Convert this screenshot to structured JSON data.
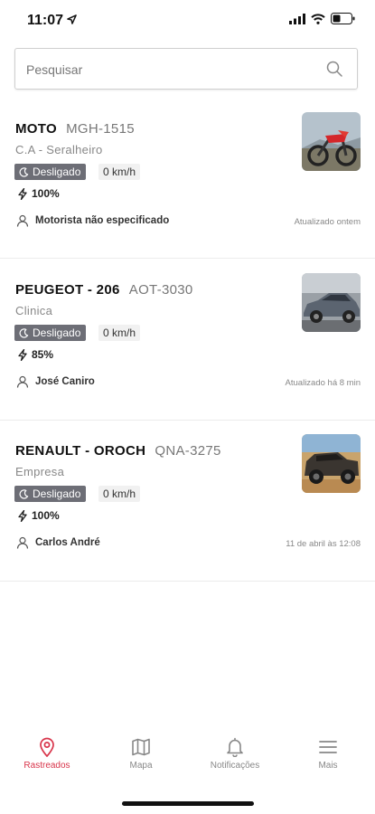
{
  "status_bar": {
    "time": "11:07"
  },
  "search": {
    "placeholder": "Pesquisar",
    "value": ""
  },
  "vehicles": [
    {
      "name": "MOTO",
      "plate": "MGH-1515",
      "group": "C.A - Seralheiro",
      "status": "Desligado",
      "speed": "0 km/h",
      "battery": "100%",
      "driver": "Motorista não especificado",
      "updated": "Atualizado ontem",
      "image": "red dirt motorcycle"
    },
    {
      "name": "PEUGEOT - 206",
      "plate": "AOT-3030",
      "group": "Clinica",
      "status": "Desligado",
      "speed": "0 km/h",
      "battery": "85%",
      "driver": "José Caniro",
      "updated": "Atualizado há 8 min",
      "image": "grey hatchback car"
    },
    {
      "name": "RENAULT - OROCH",
      "plate": "QNA-3275",
      "group": "Empresa",
      "status": "Desligado",
      "speed": "0 km/h",
      "battery": "100%",
      "driver": "Carlos André",
      "updated": "11 de abril às 12:08",
      "image": "dark pickup truck"
    }
  ],
  "tabbar": {
    "items": [
      {
        "label": "Rastreados",
        "icon": "location-pin-icon",
        "active": true
      },
      {
        "label": "Mapa",
        "icon": "map-icon",
        "active": false
      },
      {
        "label": "Notificações",
        "icon": "bell-icon",
        "active": false
      },
      {
        "label": "Mais",
        "icon": "menu-icon",
        "active": false
      }
    ]
  },
  "colors": {
    "accent": "#d8344a",
    "status_badge_bg": "#6d6e76",
    "speed_badge_bg": "#f1f1f1",
    "muted_text": "#888888"
  }
}
